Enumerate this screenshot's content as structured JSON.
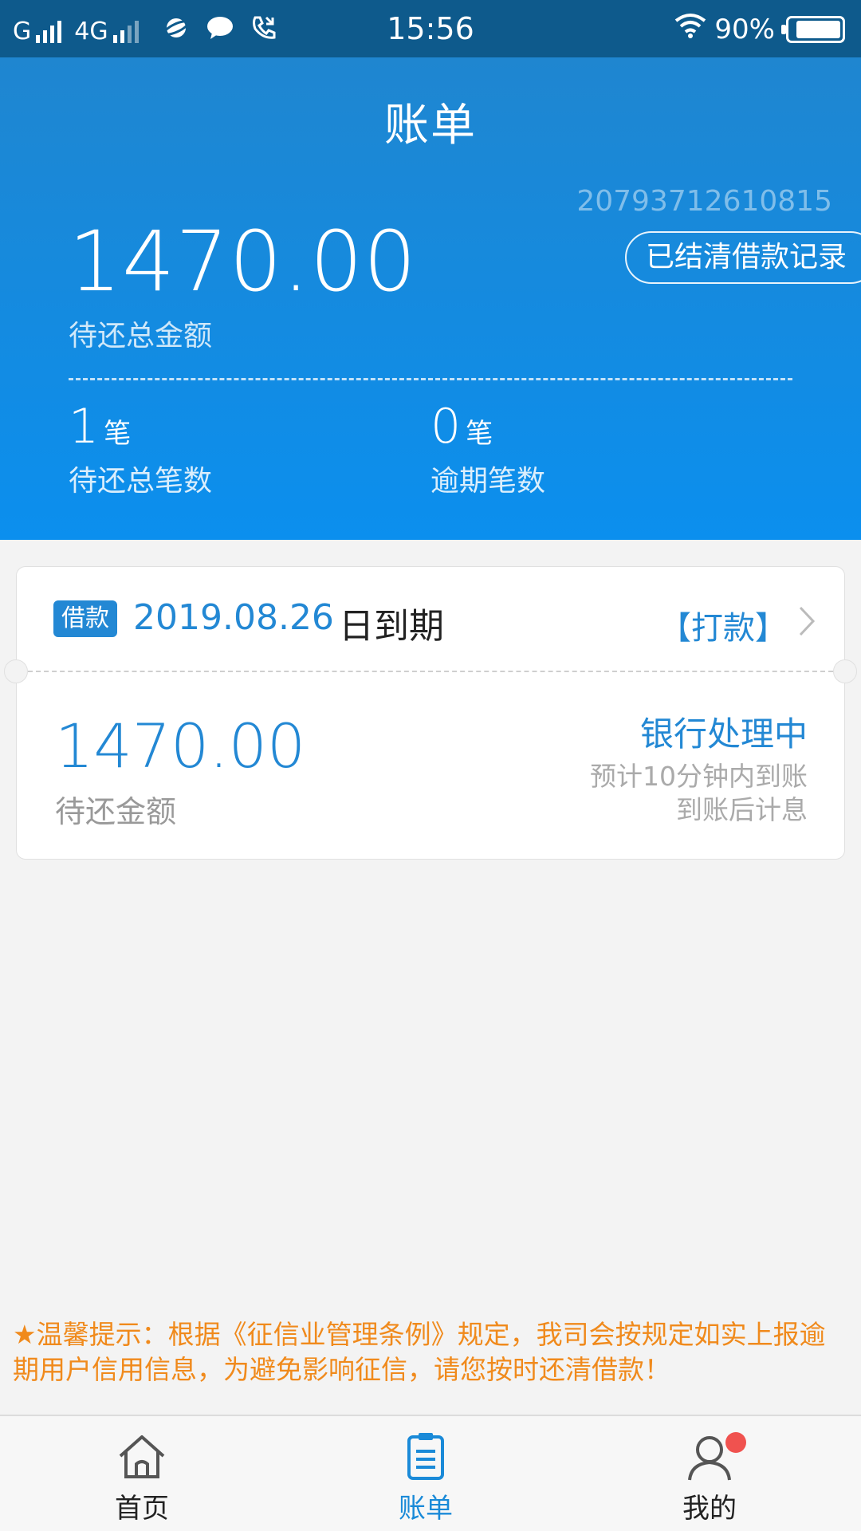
{
  "status_bar": {
    "carrier1": "G",
    "carrier2": "4G",
    "time": "15:56",
    "battery": "90%",
    "battery_level": 0.9,
    "icons": [
      "signal-icon",
      "saturn-icon",
      "chat-icon",
      "phone-call-icon",
      "wifi-icon",
      "battery-icon"
    ]
  },
  "header": {
    "title": "账单",
    "account_number": "20793712610815",
    "settled_button": "已结清借款记录",
    "total_amount": "1470.00",
    "total_amount_label": "待还总金额",
    "stats": [
      {
        "value": "1",
        "unit": "笔",
        "label": "待还总笔数"
      },
      {
        "value": "0",
        "unit": "笔",
        "label": "逾期笔数"
      }
    ]
  },
  "bill_card": {
    "tag": "借款",
    "due_date": "2019.08.26",
    "due_suffix": "日到期",
    "action": "【打款】",
    "amount": "1470.00",
    "amount_label": "待还金额",
    "status": "银行处理中",
    "status_sub1": "预计10分钟内到账",
    "status_sub2": "到账后计息"
  },
  "notice": "★温馨提示：根据《征信业管理条例》规定，我司会按规定如实上报逾期用户信用信息，为避免影响征信，请您按时还清借款！",
  "tabs": [
    {
      "label": "首页",
      "icon": "home-icon",
      "active": false
    },
    {
      "label": "账单",
      "icon": "bill-icon",
      "active": true
    },
    {
      "label": "我的",
      "icon": "profile-icon",
      "active": false
    }
  ],
  "colors": {
    "accent": "#2388d4",
    "header_top": "#1f86d0",
    "header_bottom": "#0b8fee",
    "status_bar": "#0e5a8c",
    "notice": "#f08a1c",
    "badge": "#f0524f"
  }
}
